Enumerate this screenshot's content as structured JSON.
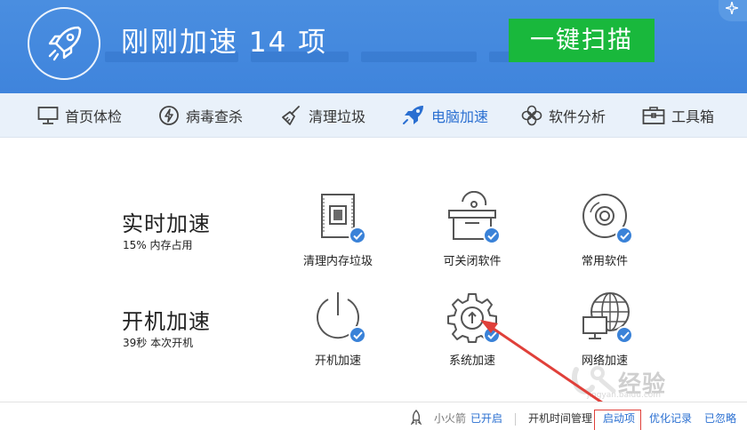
{
  "header": {
    "title": "刚刚加速 14 项",
    "scan_button": "一键扫描",
    "logo_icon": "rocket-icon",
    "corner_icon": "sparkle-icon"
  },
  "nav": {
    "items": [
      {
        "label": "首页体检",
        "icon": "monitor-icon"
      },
      {
        "label": "病毒查杀",
        "icon": "lightning-shield-icon"
      },
      {
        "label": "清理垃圾",
        "icon": "broom-icon"
      },
      {
        "label": "电脑加速",
        "icon": "rocket-icon",
        "active": true
      },
      {
        "label": "软件分析",
        "icon": "flower-icon"
      },
      {
        "label": "工具箱",
        "icon": "toolbox-icon"
      }
    ]
  },
  "realtime": {
    "title": "实时加速",
    "subtitle": "15% 内存占用",
    "tools": [
      {
        "label": "清理内存垃圾",
        "icon": "memory-chip-icon"
      },
      {
        "label": "可关闭软件",
        "icon": "box-disc-icon"
      },
      {
        "label": "常用软件",
        "icon": "disc-icon"
      }
    ]
  },
  "startup": {
    "title": "开机加速",
    "subtitle": "39秒 本次开机",
    "tools": [
      {
        "label": "开机加速",
        "icon": "power-icon"
      },
      {
        "label": "系统加速",
        "icon": "gear-icon"
      },
      {
        "label": "网络加速",
        "icon": "globe-monitor-icon"
      }
    ]
  },
  "footer": {
    "rocket_label": "小火箭",
    "rocket_status": "已开启",
    "boot_time": "开机时间管理",
    "startup_items": "启动项",
    "history": "优化记录",
    "ignored": "已忽略"
  },
  "watermark": {
    "text": "经验",
    "url": "jingyan.baidu.com"
  },
  "colors": {
    "header_blue": "#4a8ee0",
    "scan_green": "#19b83c",
    "accent_blue": "#2a6fd1",
    "check_blue": "#3a82d8",
    "annotation_red": "#e0403a"
  }
}
